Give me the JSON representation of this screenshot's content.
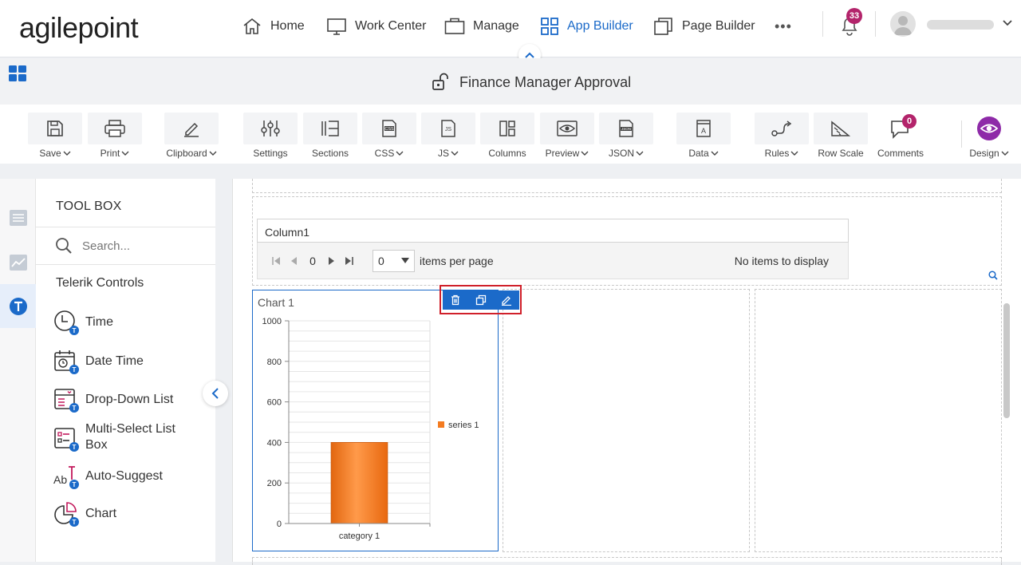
{
  "brand": {
    "logo_text": "agilepoint"
  },
  "nav": {
    "items": [
      {
        "label": "Home",
        "icon": "home-icon"
      },
      {
        "label": "Work Center",
        "icon": "monitor-icon"
      },
      {
        "label": "Manage",
        "icon": "briefcase-icon"
      },
      {
        "label": "App Builder",
        "icon": "grid-icon",
        "active": true
      },
      {
        "label": "Page Builder",
        "icon": "pages-icon"
      }
    ],
    "more_label": "•••",
    "notifications_count": "33",
    "accent_color": "#1b6ac9",
    "badge_color": "#b3246b"
  },
  "form": {
    "title": "Finance Manager Approval"
  },
  "toolbar": {
    "save": "Save",
    "print": "Print",
    "clipboard": "Clipboard",
    "settings": "Settings",
    "sections": "Sections",
    "css": "CSS",
    "js": "JS",
    "columns": "Columns",
    "preview": "Preview",
    "json": "JSON",
    "data": "Data",
    "rules": "Rules",
    "row_scale": "Row Scale",
    "comments": "Comments",
    "comments_count": "0",
    "design": "Design"
  },
  "toolbox": {
    "title": "TOOL BOX",
    "search_placeholder": "Search...",
    "category": "Telerik Controls",
    "tools": [
      {
        "label": "Time",
        "icon": "clock-icon"
      },
      {
        "label": "Date Time",
        "icon": "calendar-icon"
      },
      {
        "label": "Drop-Down List",
        "icon": "dropdown-list-icon"
      },
      {
        "label": "Multi-Select List Box",
        "icon": "multiselect-icon"
      },
      {
        "label": "Auto-Suggest",
        "icon": "autosuggest-icon"
      },
      {
        "label": "Chart",
        "icon": "pie-chart-icon"
      }
    ]
  },
  "grid": {
    "column_header": "Column1",
    "page_number": "0",
    "page_size": "0",
    "items_per_page": "items per page",
    "empty_text": "No items to display"
  },
  "chart_data": {
    "type": "bar",
    "title": "Chart 1",
    "categories": [
      "category 1"
    ],
    "series": [
      {
        "name": "series 1",
        "values": [
          400
        ],
        "color": "#f47b20"
      }
    ],
    "ylim": [
      0,
      1000
    ],
    "yticks": [
      0,
      200,
      400,
      600,
      800,
      1000
    ],
    "grid": true,
    "legend_position": "right"
  }
}
